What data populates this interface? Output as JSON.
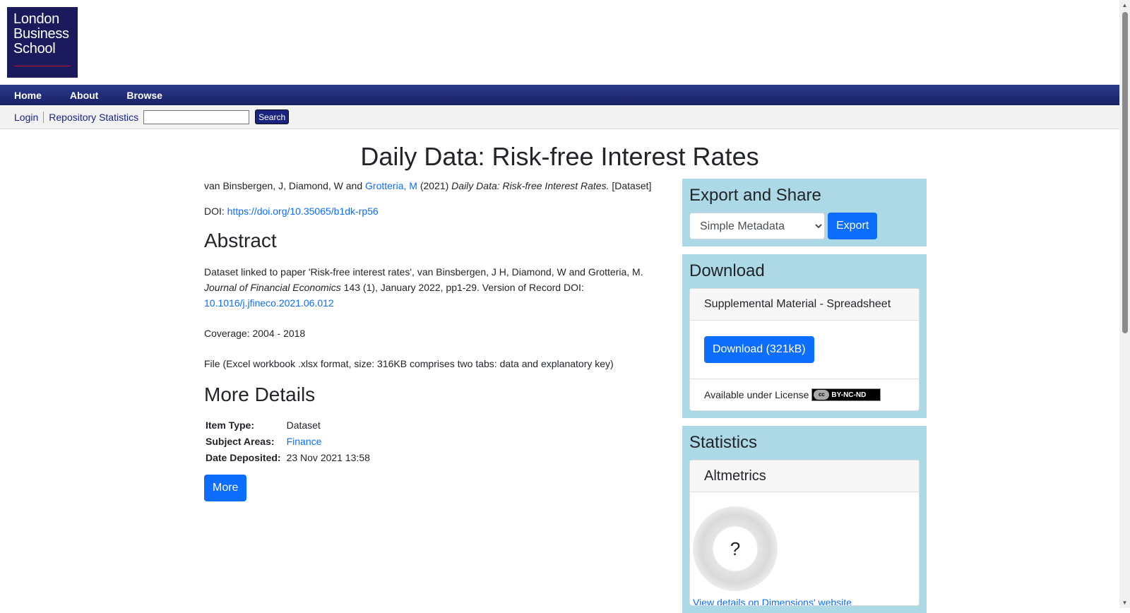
{
  "logo": {
    "line1": "London",
    "line2": "Business",
    "line3": "School"
  },
  "nav": {
    "home": "Home",
    "about": "About",
    "browse": "Browse"
  },
  "subnav": {
    "login": "Login",
    "stats": "Repository Statistics",
    "search_value": "",
    "search_button": "Search"
  },
  "title": "Daily Data: Risk-free Interest Rates",
  "citation": {
    "authors": "van Binsbergen, J, Diamond, W and",
    "linked_author": "Grotteria, M",
    "year": "(2021)",
    "title": "Daily Data: Risk-free Interest Rates.",
    "type": "[Dataset]"
  },
  "doi": {
    "label": "DOI:",
    "link": "https://doi.org/10.35065/b1dk-rp56"
  },
  "abstract": {
    "heading": "Abstract",
    "p1_text": "Dataset linked to paper 'Risk-free interest rates', van Binsbergen, J H, Diamond, W and Grotteria, M.",
    "p1_journal": "Journal of Financial Economics",
    "p1_rest": "143 (1), January 2022, pp1-29. Version of Record DOI:",
    "p1_doi": "10.1016/j.jfineco.2021.06.012",
    "p2": "Coverage: 2004 - 2018",
    "p3": "File (Excel workbook .xlsx format, size: 316KB comprises two tabs: data and explanatory key)"
  },
  "details": {
    "heading": "More Details",
    "item_type_label": "Item Type:",
    "item_type_value": "Dataset",
    "subject_label": "Subject Areas:",
    "subject_value": "Finance",
    "date_label": "Date Deposited:",
    "date_value": "23 Nov 2021 13:58",
    "more_button": "More"
  },
  "export": {
    "heading": "Export and Share",
    "selected": "Simple Metadata",
    "button": "Export"
  },
  "download": {
    "heading": "Download",
    "card_title": "Supplemental Material - Spreadsheet",
    "button": "Download (321kB)",
    "license_text": "Available under License",
    "license_badge": "BY-NC-ND",
    "cc_mark": "cc"
  },
  "statistics": {
    "heading": "Statistics",
    "card_title": "Altmetrics",
    "badge_value": "?",
    "link": "View details on Dimensions' website"
  }
}
